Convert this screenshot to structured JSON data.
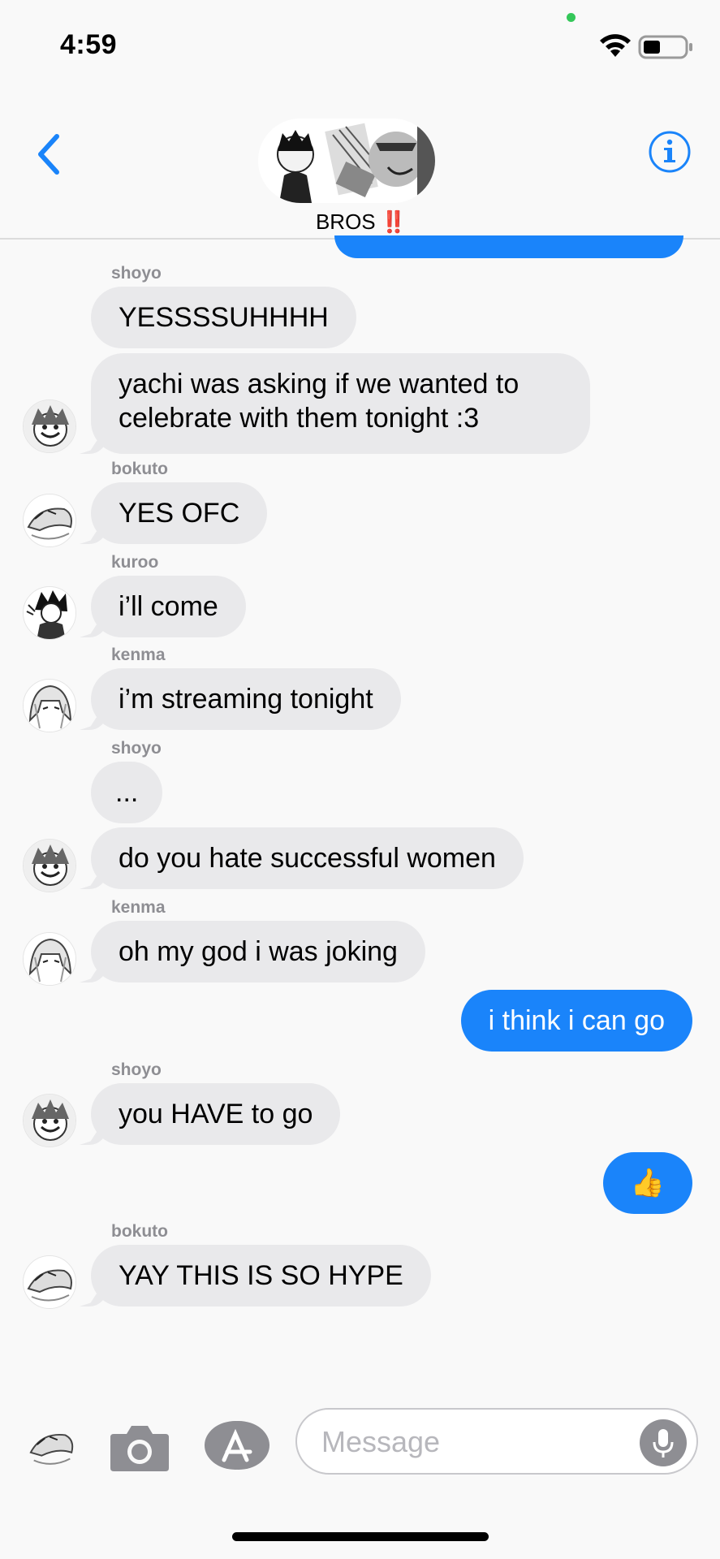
{
  "status_bar": {
    "time": "4:59"
  },
  "header": {
    "group_name": "BROS",
    "group_name_emoji": "‼️",
    "back_icon": "chevron-left-icon",
    "info_icon": "info-icon"
  },
  "colors": {
    "accent": "#1a84fa",
    "incoming_bubble": "#e9e9eb",
    "sender_label": "#8e8e93"
  },
  "messages": [
    {
      "sender": "shoyo",
      "text": "YESSSSUHHHH"
    },
    {
      "sender": "",
      "text1": "yachi was asking if we wanted to",
      "text2": "celebrate with them tonight :3"
    },
    {
      "sender": "bokuto",
      "text": "YES OFC"
    },
    {
      "sender": "kuroo",
      "text": "i’ll come"
    },
    {
      "sender": "kenma",
      "text": "i’m streaming tonight"
    },
    {
      "sender": "shoyo",
      "text": "..."
    },
    {
      "sender": "",
      "text": "do you hate successful women"
    },
    {
      "sender": "kenma",
      "text": "oh my god i was joking"
    },
    {
      "sender": "me",
      "text": "i think i can go"
    },
    {
      "sender": "shoyo",
      "text": "you HAVE to go"
    },
    {
      "sender": "me",
      "text": "👍"
    },
    {
      "sender": "bokuto",
      "text": "YAY THIS IS SO HYPE"
    }
  ],
  "input_bar": {
    "placeholder": "Message",
    "camera_icon": "camera-icon",
    "apps_icon": "app-store-icon",
    "mic_icon": "microphone-icon"
  }
}
